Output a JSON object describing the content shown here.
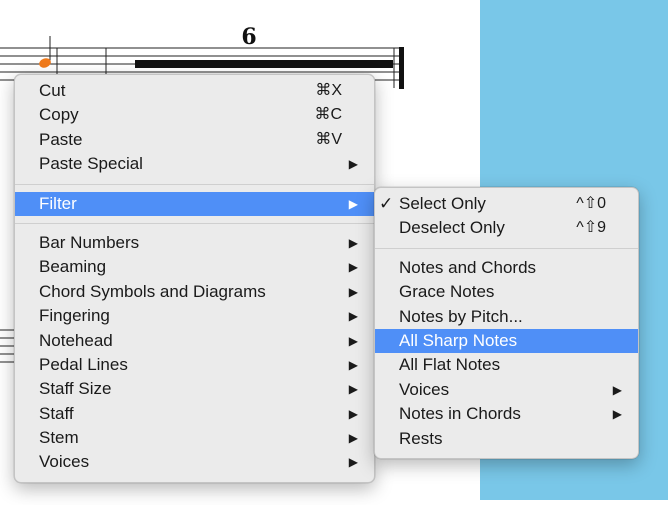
{
  "score": {
    "bar_number": "6"
  },
  "context_menu": {
    "group1": [
      {
        "label": "Cut",
        "shortcut": "⌘X"
      },
      {
        "label": "Copy",
        "shortcut": "⌘C"
      },
      {
        "label": "Paste",
        "shortcut": "⌘V"
      },
      {
        "label": "Paste Special",
        "submenu": true
      }
    ],
    "filter": {
      "label": "Filter",
      "submenu": true,
      "highlighted": true
    },
    "group3": [
      {
        "label": "Bar Numbers"
      },
      {
        "label": "Beaming"
      },
      {
        "label": "Chord Symbols and Diagrams"
      },
      {
        "label": "Fingering"
      },
      {
        "label": "Notehead"
      },
      {
        "label": "Pedal Lines"
      },
      {
        "label": "Staff Size"
      },
      {
        "label": "Staff"
      },
      {
        "label": "Stem"
      },
      {
        "label": "Voices"
      }
    ]
  },
  "filter_submenu": {
    "group1": [
      {
        "label": "Select Only",
        "shortcut": "^⇧0",
        "checked": true
      },
      {
        "label": "Deselect Only",
        "shortcut": "^⇧9"
      }
    ],
    "group2": [
      {
        "label": "Notes and Chords"
      },
      {
        "label": "Grace Notes"
      },
      {
        "label": "Notes by Pitch..."
      },
      {
        "label": "All Sharp Notes",
        "highlighted": true
      },
      {
        "label": "All Flat Notes"
      },
      {
        "label": "Voices",
        "submenu": true
      },
      {
        "label": "Notes in Chords",
        "submenu": true
      },
      {
        "label": "Rests"
      }
    ]
  },
  "symbols": {
    "submenu_arrow": "▶",
    "checkmark": "✓"
  },
  "colors": {
    "highlight": "#4f8ff7",
    "menu_bg": "#ebebeb",
    "side_pane": "#79c7e8",
    "note": "#f07a1a"
  }
}
